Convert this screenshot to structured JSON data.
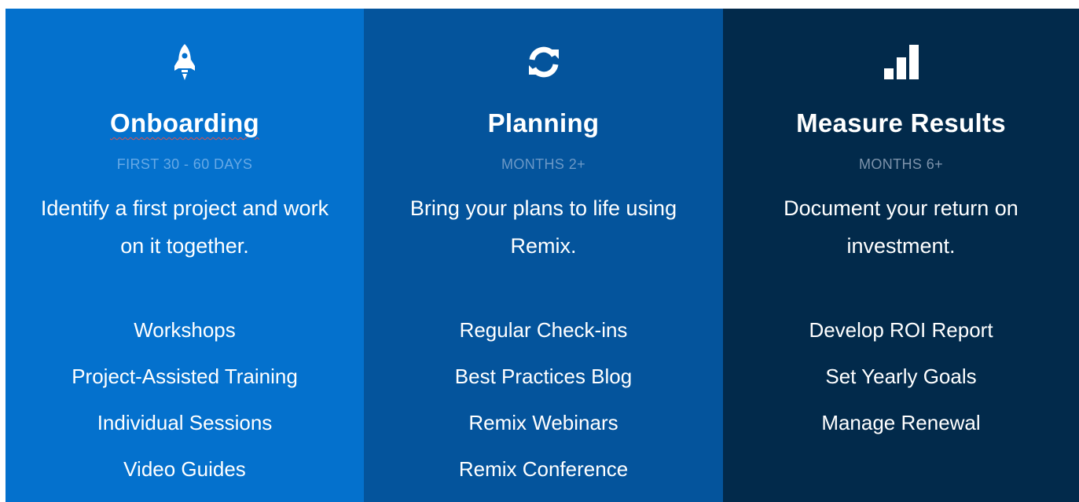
{
  "columns": [
    {
      "icon": "rocket-icon",
      "title": "Onboarding",
      "subtitle": "FIRST 30 - 60 DAYS",
      "description": "Identify a first project and work on it together.",
      "items": [
        "Workshops",
        "Project-Assisted Training",
        "Individual Sessions",
        "Video Guides"
      ],
      "background": "#0471cd"
    },
    {
      "icon": "refresh-icon",
      "title": "Planning",
      "subtitle": "MONTHS 2+",
      "description": "Bring your plans to life using Remix.",
      "items": [
        "Regular Check-ins",
        "Best Practices Blog",
        "Remix Webinars",
        "Remix Conference"
      ],
      "background": "#04549c"
    },
    {
      "icon": "bar-chart-icon",
      "title": "Measure Results",
      "subtitle": "MONTHS 6+",
      "description": "Document your return on investment.",
      "items": [
        "Develop ROI Report",
        "Set Yearly Goals",
        "Manage Renewal"
      ],
      "background": "#022a4b"
    }
  ]
}
